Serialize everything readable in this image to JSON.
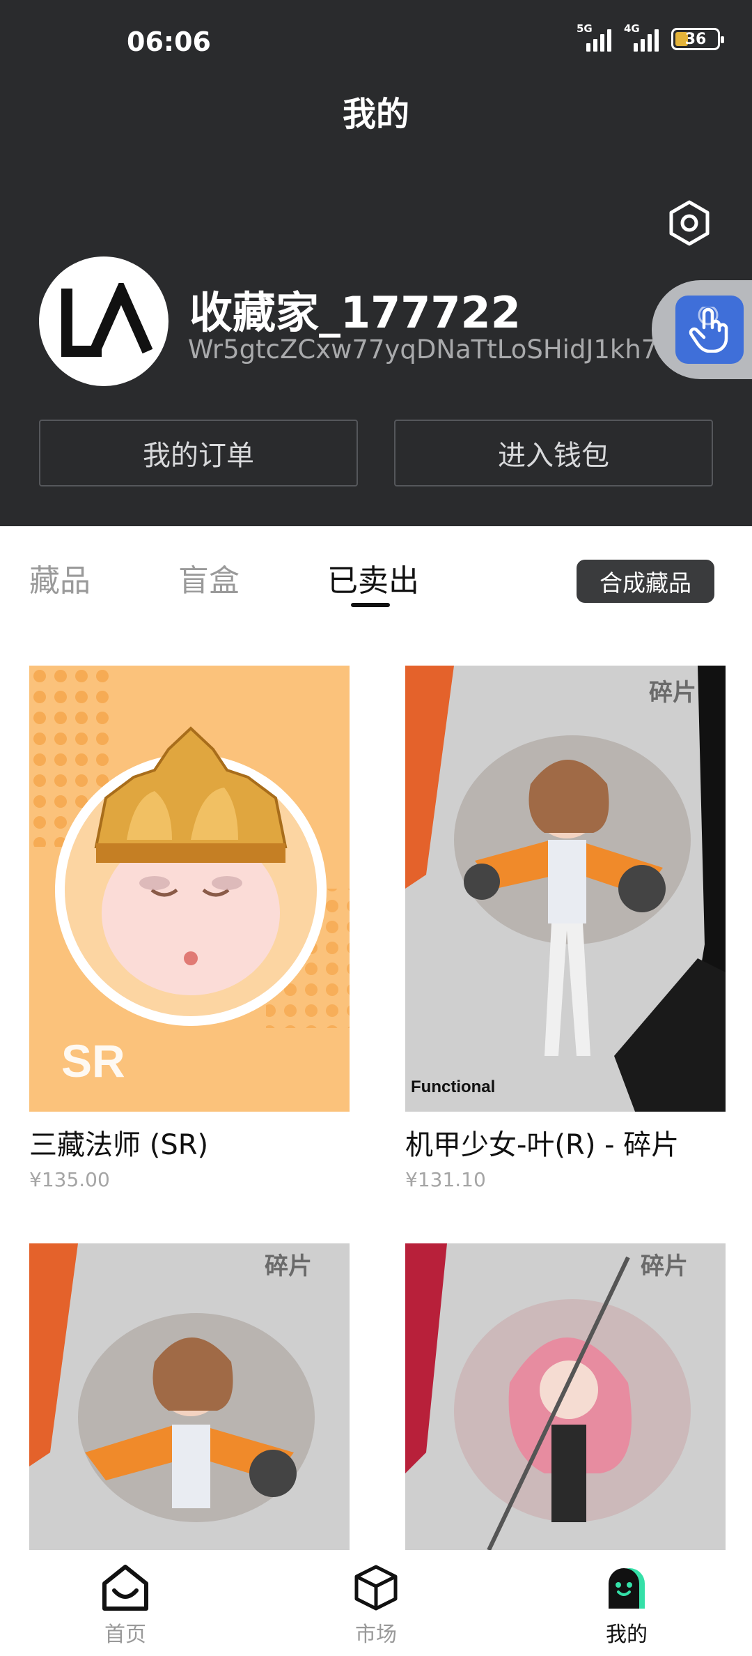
{
  "status_bar": {
    "time": "06:06",
    "signal_5g": "5G",
    "signal_4g": "4G",
    "battery": "36"
  },
  "header": {
    "title": "我的",
    "username": "收藏家_177722",
    "address": "Wr5gtcZCxw77yqDNaTtLoSHidJ1kh7Gy1",
    "orders_label": "我的订单",
    "wallet_label": "进入钱包"
  },
  "tabs": [
    {
      "label": "藏品",
      "active": false
    },
    {
      "label": "盲盒",
      "active": false
    },
    {
      "label": "已卖出",
      "active": true
    }
  ],
  "synth_label": "合成藏品",
  "items": [
    {
      "title": "三藏法师 (SR)",
      "price": "¥135.00",
      "badge": "SR"
    },
    {
      "title": "机甲少女-叶(R) - 碎片",
      "price": "¥131.10",
      "badge": "碎片",
      "caption": "Functional"
    },
    {
      "title": "",
      "price": "",
      "badge": "碎片"
    },
    {
      "title": "",
      "price": "",
      "badge": "碎片"
    }
  ],
  "bottom_nav": [
    {
      "label": "首页",
      "icon": "home-icon",
      "active": false
    },
    {
      "label": "市场",
      "icon": "cube-icon",
      "active": false
    },
    {
      "label": "我的",
      "icon": "ghost-icon",
      "active": true
    }
  ],
  "colors": {
    "header_bg": "#2a2b2d",
    "accent_blue": "#3f6fd9",
    "battery_yellow": "#e3b33a",
    "card_orange": "#fbc27b"
  }
}
